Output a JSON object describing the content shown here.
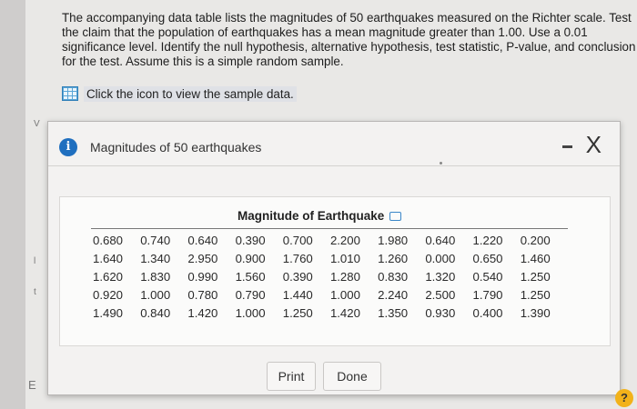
{
  "question": {
    "lines": [
      "The accompanying data table lists the magnitudes of 50 earthquakes measured on the Richter scale. Test",
      "the claim that the population of earthquakes has a mean magnitude greater than 1.00. Use a 0.01",
      "significance level. Identify the null hypothesis, alternative hypothesis, test statistic, P-value, and conclusion",
      "for the test. Assume this is a simple random sample."
    ]
  },
  "sample_link": {
    "icon": "grid-table-icon",
    "label": "Click the icon to view the sample data."
  },
  "side_marks": [
    "V",
    "l",
    "t",
    "E"
  ],
  "dialog": {
    "title": "Magnitudes of 50 earthquakes",
    "info_icon": "i",
    "minimize_icon": "-",
    "close_icon": "X",
    "table_heading": "Magnitude of Earthquake",
    "rows": [
      [
        "0.680",
        "0.740",
        "0.640",
        "0.390",
        "0.700",
        "2.200",
        "1.980",
        "0.640",
        "1.220",
        "0.200"
      ],
      [
        "1.640",
        "1.340",
        "2.950",
        "0.900",
        "1.760",
        "1.010",
        "1.260",
        "0.000",
        "0.650",
        "1.460"
      ],
      [
        "1.620",
        "1.830",
        "0.990",
        "1.560",
        "0.390",
        "1.280",
        "0.830",
        "1.320",
        "0.540",
        "1.250"
      ],
      [
        "0.920",
        "1.000",
        "0.780",
        "0.790",
        "1.440",
        "1.000",
        "2.240",
        "2.500",
        "1.790",
        "1.250"
      ],
      [
        "1.490",
        "0.840",
        "1.420",
        "1.000",
        "1.250",
        "1.420",
        "1.350",
        "0.930",
        "0.400",
        "1.390"
      ]
    ],
    "print_label": "Print",
    "done_label": "Done"
  },
  "help_icon": "?",
  "colors": {
    "accent": "#1f6fbf",
    "help": "#f2b21a"
  }
}
